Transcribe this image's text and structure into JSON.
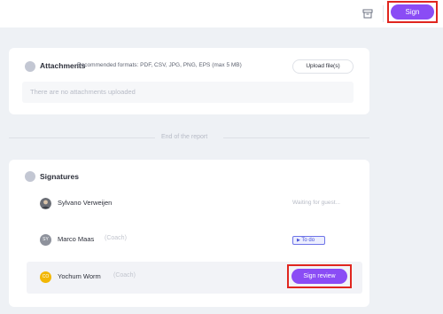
{
  "header": {
    "archive_icon": "archive-icon",
    "sign_label": "Sign",
    "accent": "#8a4cf5",
    "highlight": "#e0261f"
  },
  "attachments": {
    "title": "Attachments",
    "formats": "Recommended formats: PDF, CSV, JPG, PNG, EPS (max 5 MB)",
    "upload_label": "Upload file(s)",
    "empty": "There are no attachments uploaded"
  },
  "end_of_report": "End of the report",
  "signatures": {
    "title": "Signatures",
    "rows": [
      {
        "name": "Sylvano Verweijen",
        "role": "",
        "status": "Waiting for guest...",
        "avatar": "photo"
      },
      {
        "name": "Marco Maas",
        "role": "(Coach)",
        "status": "To do",
        "avatar": "SY",
        "avatar_color": "#8e929c"
      },
      {
        "name": "Yochum Worm",
        "role": "(Coach)",
        "action": "Sign review",
        "avatar": "CO",
        "avatar_color": "#f2b705"
      }
    ]
  }
}
